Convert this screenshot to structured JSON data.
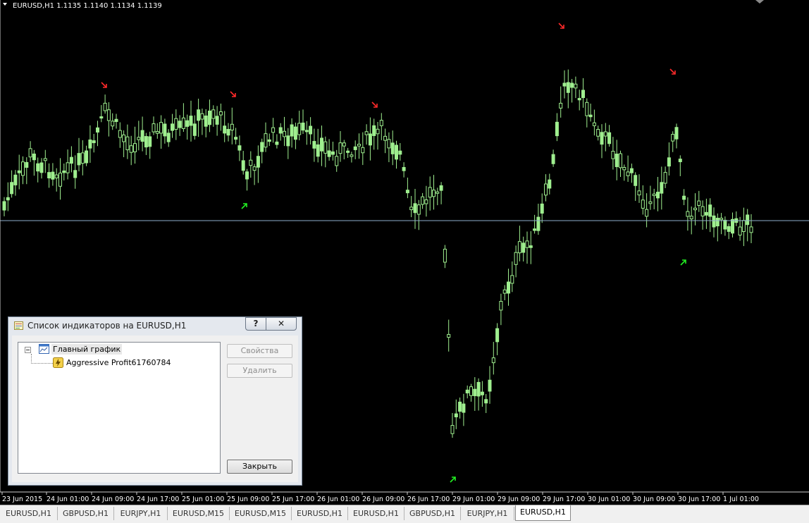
{
  "chart": {
    "header": "EURUSD,H1  1.1135 1.1140 1.1134 1.1139",
    "time_axis": [
      "23 Jun 2015",
      "24 Jun 01:00",
      "24 Jun 09:00",
      "24 Jun 17:00",
      "25 Jun 01:00",
      "25 Jun 09:00",
      "25 Jun 17:00",
      "26 Jun 01:00",
      "26 Jun 09:00",
      "26 Jun 17:00",
      "29 Jun 01:00",
      "29 Jun 09:00",
      "29 Jun 17:00",
      "30 Jun 01:00",
      "30 Jun 09:00",
      "30 Jun 17:00",
      "1 Jul 01:00"
    ],
    "candle_color": "#9fef8f",
    "bg_color": "#000000",
    "arrow_down_color": "#ff2a2a",
    "arrow_up_color": "#22ee22",
    "hline_color": "#8eaecc"
  },
  "dialog": {
    "title": "Список индикаторов на EURUSD,H1",
    "help_button": "?",
    "close_x": "✕",
    "tree": {
      "root_label": "Главный график",
      "child_label": "Aggressive Profit61760784"
    },
    "buttons": {
      "properties": "Свойства",
      "delete": "Удалить",
      "close": "Закрыть"
    }
  },
  "tabs": [
    "EURUSD,H1",
    "GBPUSD,H1",
    "EURJPY,H1",
    "EURUSD,M15",
    "EURUSD,M15",
    "EURUSD,H1",
    "EURUSD,H1",
    "GBPUSD,H1",
    "EURJPY,H1",
    "EURUSD,H1"
  ],
  "active_tab_index": 9
}
